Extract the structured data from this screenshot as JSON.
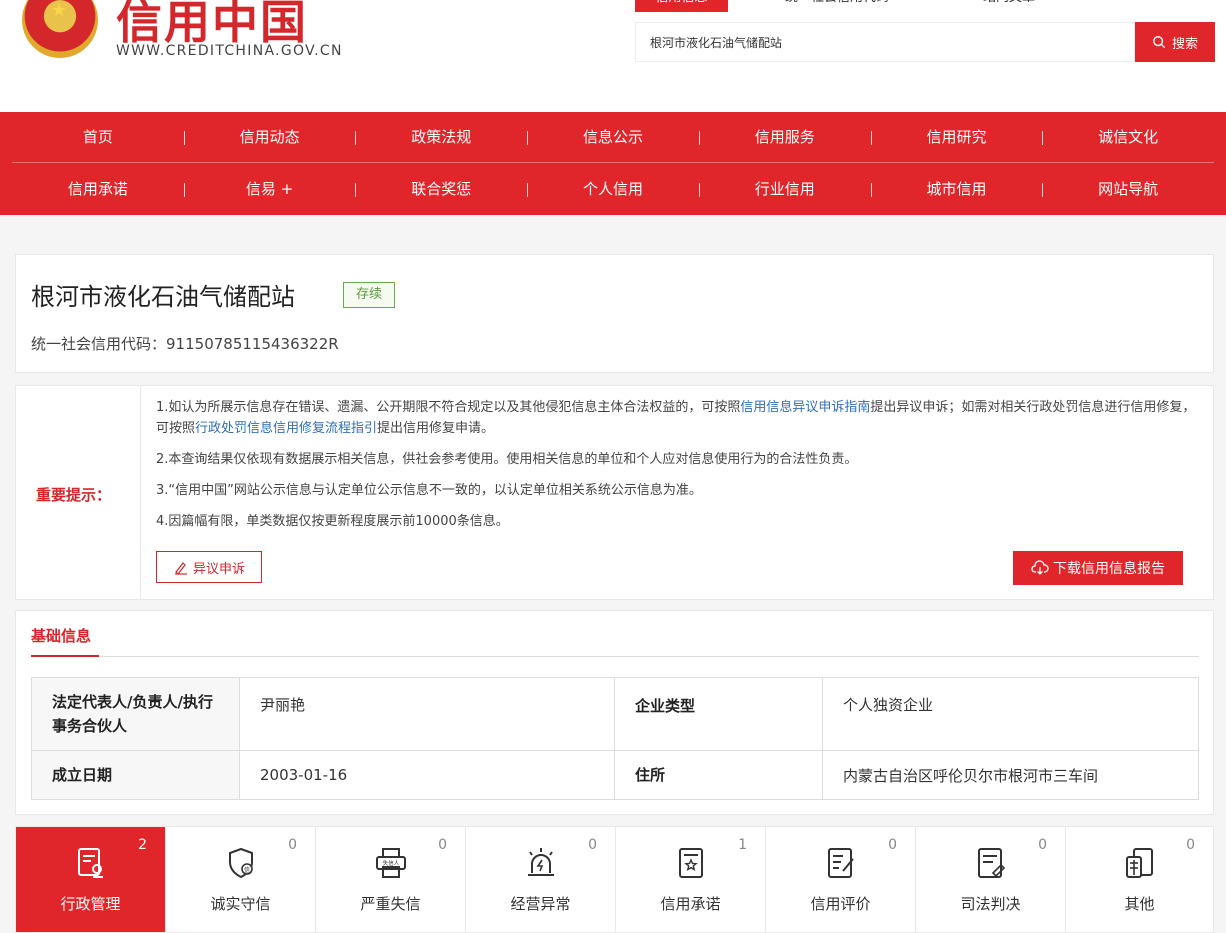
{
  "header": {
    "logo_text": "信用中国",
    "logo_url": "WWW.CREDITCHINA.GOV.CN",
    "top_tabs": [
      "信用信息",
      "统一社会信用代码",
      "站内文章"
    ],
    "search_value": "根河市液化石油气储配站",
    "search_button": "搜索"
  },
  "nav": {
    "row1": [
      "首页",
      "信用动态",
      "政策法规",
      "信息公示",
      "信用服务",
      "信用研究",
      "诚信文化"
    ],
    "row2": [
      "信用承诺",
      "信易 +",
      "联合奖惩",
      "个人信用",
      "行业信用",
      "城市信用",
      "网站导航"
    ]
  },
  "entity": {
    "name": "根河市液化石油气储配站",
    "status": "存续",
    "credit_code_label": "统一社会信用代码：",
    "credit_code": "91150785115436322R"
  },
  "notice": {
    "label": "重要提示：",
    "p1_a": "1.如认为所展示信息存在错误、遗漏、公开期限不符合规定以及其他侵犯信息主体合法权益的，可按照",
    "p1_link1": "信用信息异议申诉指南",
    "p1_b": "提出异议申诉；如需对相关行政处罚信息进行信用修复，可按照",
    "p1_link2": "行政处罚信息信用修复流程指引",
    "p1_c": "提出信用修复申请。",
    "p2": "2.本查询结果仅依现有数据展示相关信息，供社会参考使用。使用相关信息的单位和个人应对信息使用行为的合法性负责。",
    "p3": "3.“信用中国”网站公示信息与认定单位公示信息不一致的，以认定单位相关系统公示信息为准。",
    "p4": "4.因篇幅有限，单类数据仅按更新程度展示前10000条信息。",
    "objection_button": "异议申诉",
    "download_button": "下载信用信息报告"
  },
  "basic": {
    "title": "基础信息",
    "rows": [
      {
        "k1": "法定代表人/负责人/执行事务合伙人",
        "v1": "尹丽艳",
        "k2": "企业类型",
        "v2": "个人独资企业"
      },
      {
        "k1": "成立日期",
        "v1": "2003-01-16",
        "k2": "住所",
        "v2": "内蒙古自治区呼伦贝尔市根河市三车间"
      }
    ]
  },
  "categories": [
    {
      "label": "行政管理",
      "count": "2",
      "icon": "admin-doc-icon"
    },
    {
      "label": "诚实守信",
      "count": "0",
      "icon": "shield-icon"
    },
    {
      "label": "严重失信",
      "count": "0",
      "icon": "printer-icon"
    },
    {
      "label": "经营异常",
      "count": "0",
      "icon": "alarm-icon"
    },
    {
      "label": "信用承诺",
      "count": "1",
      "icon": "certificate-icon"
    },
    {
      "label": "信用评价",
      "count": "0",
      "icon": "evaluation-icon"
    },
    {
      "label": "司法判决",
      "count": "0",
      "icon": "judgment-icon"
    },
    {
      "label": "其他",
      "count": "0",
      "icon": "other-icon"
    }
  ],
  "colors": {
    "brand": "#e0262a",
    "status": "#5a9a3c",
    "link": "#2f6fb8"
  }
}
